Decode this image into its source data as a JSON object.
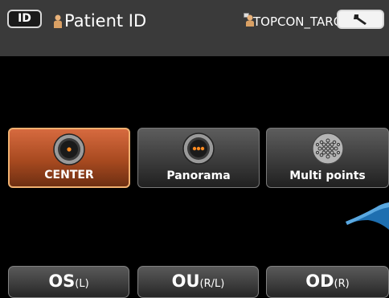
{
  "header": {
    "id_button_label": "ID",
    "patient_id_label": "Patient ID",
    "operator_label": "TOPCON_TAROU"
  },
  "modes": [
    {
      "label": "CENTER",
      "state": "selected",
      "icon": "single-dot-target-icon"
    },
    {
      "label": "Panorama",
      "state": "normal",
      "icon": "three-dot-target-icon"
    },
    {
      "label": "Multi points",
      "state": "normal",
      "icon": "multi-dot-target-icon"
    }
  ],
  "eye_buttons": [
    {
      "label": "OS",
      "sub": "(L)"
    },
    {
      "label": "OU",
      "sub": "(R/L)"
    },
    {
      "label": "OD",
      "sub": "(R)"
    }
  ],
  "colors": {
    "selected_orange": "#b85426",
    "header_gray": "#3a3a3a",
    "target_dot_orange": "#ff8a20",
    "decor_blue": "#1e6fb0"
  }
}
